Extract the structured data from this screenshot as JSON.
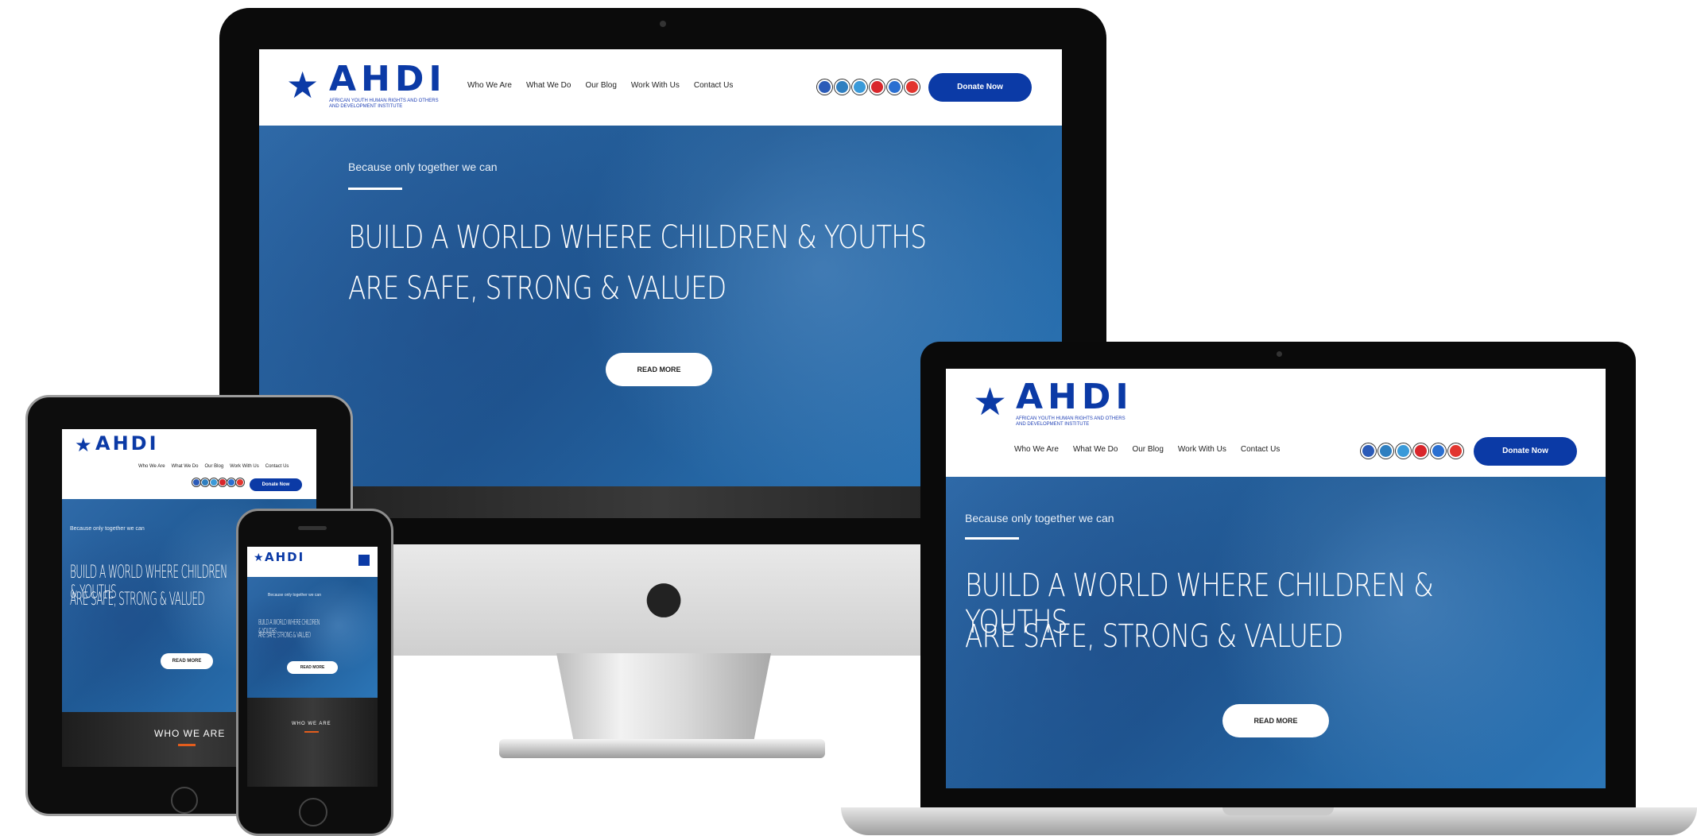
{
  "brand": {
    "name": "AHDI",
    "tagline_sub": "AFRICAN YOUTH HUMAN RIGHTS AND OTHERS AND DEVELOPMENT INSTITUTE"
  },
  "nav": {
    "menu": [
      "Who We Are",
      "What We Do",
      "Our Blog",
      "Work With Us",
      "Contact Us"
    ],
    "donate_label": "Donate Now",
    "social_icons": [
      "facebook-icon",
      "linkedin-icon",
      "instagram-icon",
      "youtube-icon",
      "twitter-icon",
      "pinterest-icon"
    ]
  },
  "hero": {
    "tagline": "Because only together we can",
    "headline_line1": "BUILD A WORLD WHERE CHILDREN & YOUTHS",
    "headline_line2": "ARE SAFE, STRONG & VALUED",
    "read_more": "READ MORE"
  },
  "section": {
    "who_we_are": "WHO WE ARE"
  },
  "colors": {
    "brand_blue": "#0b3aa6",
    "hero_blue": "#2464a6",
    "accent_orange": "#e35d1d"
  }
}
